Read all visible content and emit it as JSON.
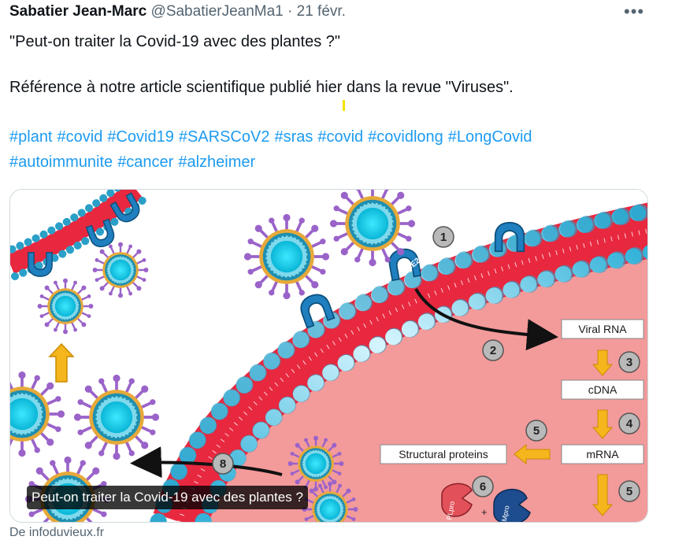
{
  "tweet": {
    "author_name": "Sabatier Jean-Marc",
    "handle": "@SabatierJeanMa1",
    "separator": "·",
    "date": "21 févr.",
    "more_glyph": "•••",
    "line1": "\"Peut-on traiter la Covid-19 avec des plantes ?\"",
    "line2": "Référence à notre article scientifique publié hier dans la revue \"Viruses\".",
    "hashtags_row1": [
      "#plant",
      "#covid",
      "#Covid19",
      "#SARSCoV2",
      "#sras",
      "#covid",
      "#covidlong",
      "#LongCovid"
    ],
    "hashtags_row2": [
      "#autoimmunite",
      "#cancer",
      "#alzheimer"
    ]
  },
  "card": {
    "caption": "Peut-on traiter la Covid-19 avec des plantes ?",
    "source": "De infoduvieux.fr",
    "diagram": {
      "receptor_label": "ACE2",
      "boxes": {
        "viral_rna": "Viral RNA",
        "cdna": "cDNA",
        "mrna": "mRNA",
        "structural": "Structural proteins"
      },
      "steps": [
        "1",
        "2",
        "3",
        "4",
        "5",
        "5",
        "6",
        "8"
      ],
      "protease_labels": [
        "PLpro",
        "+",
        "Mpro"
      ]
    }
  }
}
